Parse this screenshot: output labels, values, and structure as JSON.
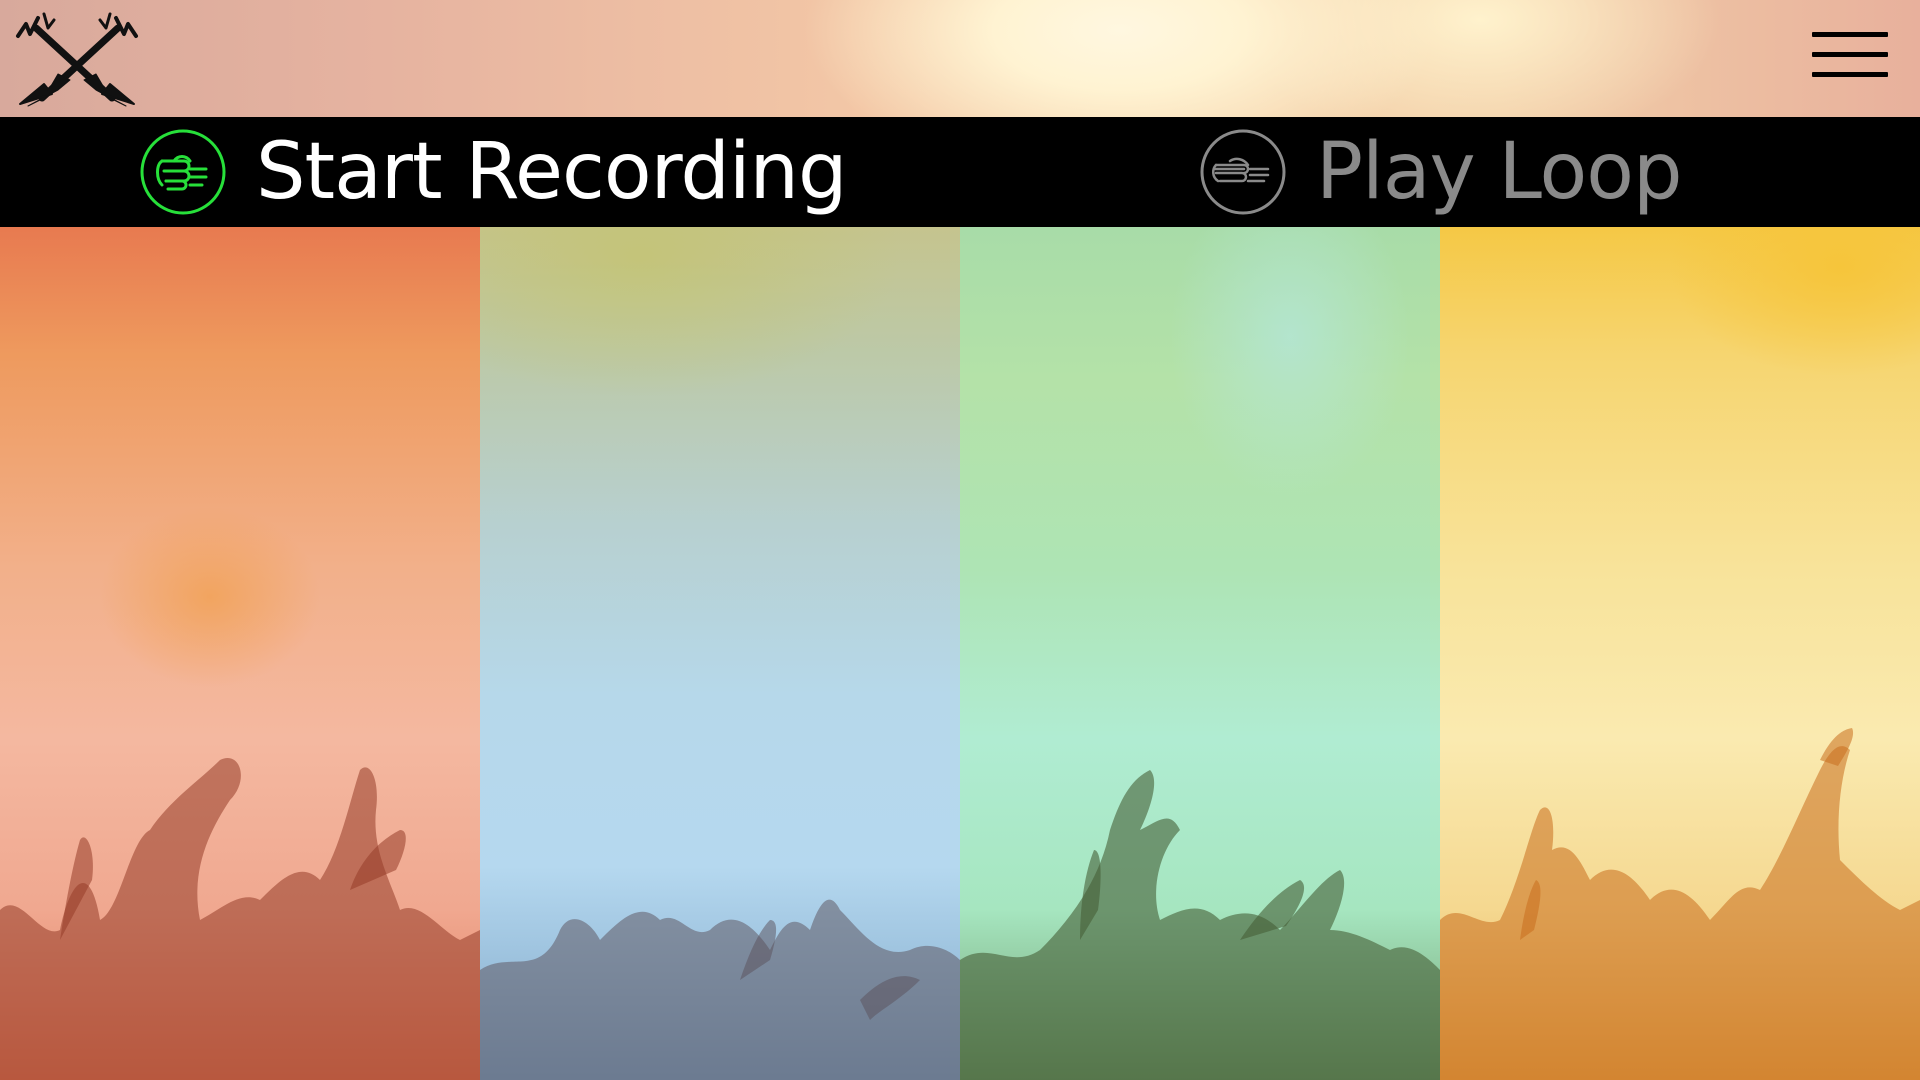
{
  "app": {
    "logo_icon": "crossed-guitars-icon",
    "menu_icon": "hamburger-menu-icon"
  },
  "controls": {
    "record": {
      "label": "Start Recording",
      "icon": "fist-gesture-icon",
      "accent": "#27e03a"
    },
    "play": {
      "label": "Play Loop",
      "icon": "flat-hand-gesture-icon",
      "accent": "#8a8a8a"
    }
  },
  "pads": [
    {
      "color": "#f0a890"
    },
    {
      "color": "#b6d8ea"
    },
    {
      "color": "#aee4b4"
    },
    {
      "color": "#f8e39a"
    }
  ]
}
